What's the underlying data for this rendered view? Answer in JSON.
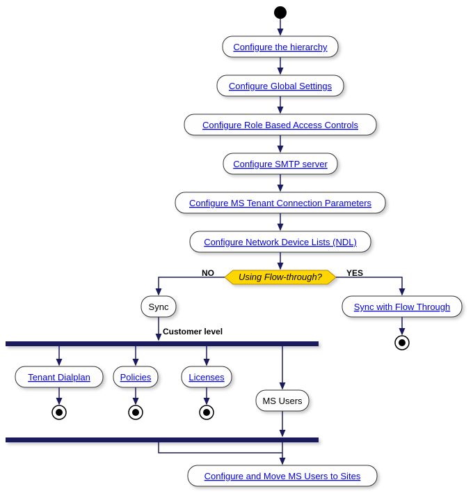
{
  "chart_data": {
    "type": "activity-diagram",
    "start": true,
    "nodes": [
      {
        "id": "n1",
        "label": "Configure the hierarchy",
        "link": true
      },
      {
        "id": "n2",
        "label": "Configure Global Settings",
        "link": true
      },
      {
        "id": "n3",
        "label": "Configure Role Based Access Controls",
        "link": true
      },
      {
        "id": "n4",
        "label": "Configure SMTP server",
        "link": true
      },
      {
        "id": "n5",
        "label": "Configure MS Tenant Connection Parameters",
        "link": true
      },
      {
        "id": "n6",
        "label": "Configure Network Device Lists (NDL)",
        "link": true
      },
      {
        "id": "d1",
        "label": "Using Flow-through?",
        "type": "decision",
        "branches": {
          "NO": "sync",
          "YES": "syncflow"
        }
      },
      {
        "id": "sync",
        "label": "Sync",
        "link": false
      },
      {
        "id": "syncflow",
        "label": "Sync with Flow Through",
        "link": true,
        "end_after": true
      },
      {
        "id": "fork",
        "type": "fork",
        "label": "Customer level"
      },
      {
        "id": "p1",
        "label": "Tenant Dialplan",
        "link": true,
        "end_after": true
      },
      {
        "id": "p2",
        "label": "Policies",
        "link": true,
        "end_after": true
      },
      {
        "id": "p3",
        "label": "Licenses",
        "link": true,
        "end_after": true
      },
      {
        "id": "p4",
        "label": "MS Users",
        "link": false
      },
      {
        "id": "join",
        "type": "join"
      },
      {
        "id": "n7",
        "label": "Configure and Move MS Users to Sites",
        "link": true
      }
    ],
    "labels": {
      "no": "NO",
      "yes": "YES",
      "fork_label": "Customer level"
    }
  }
}
